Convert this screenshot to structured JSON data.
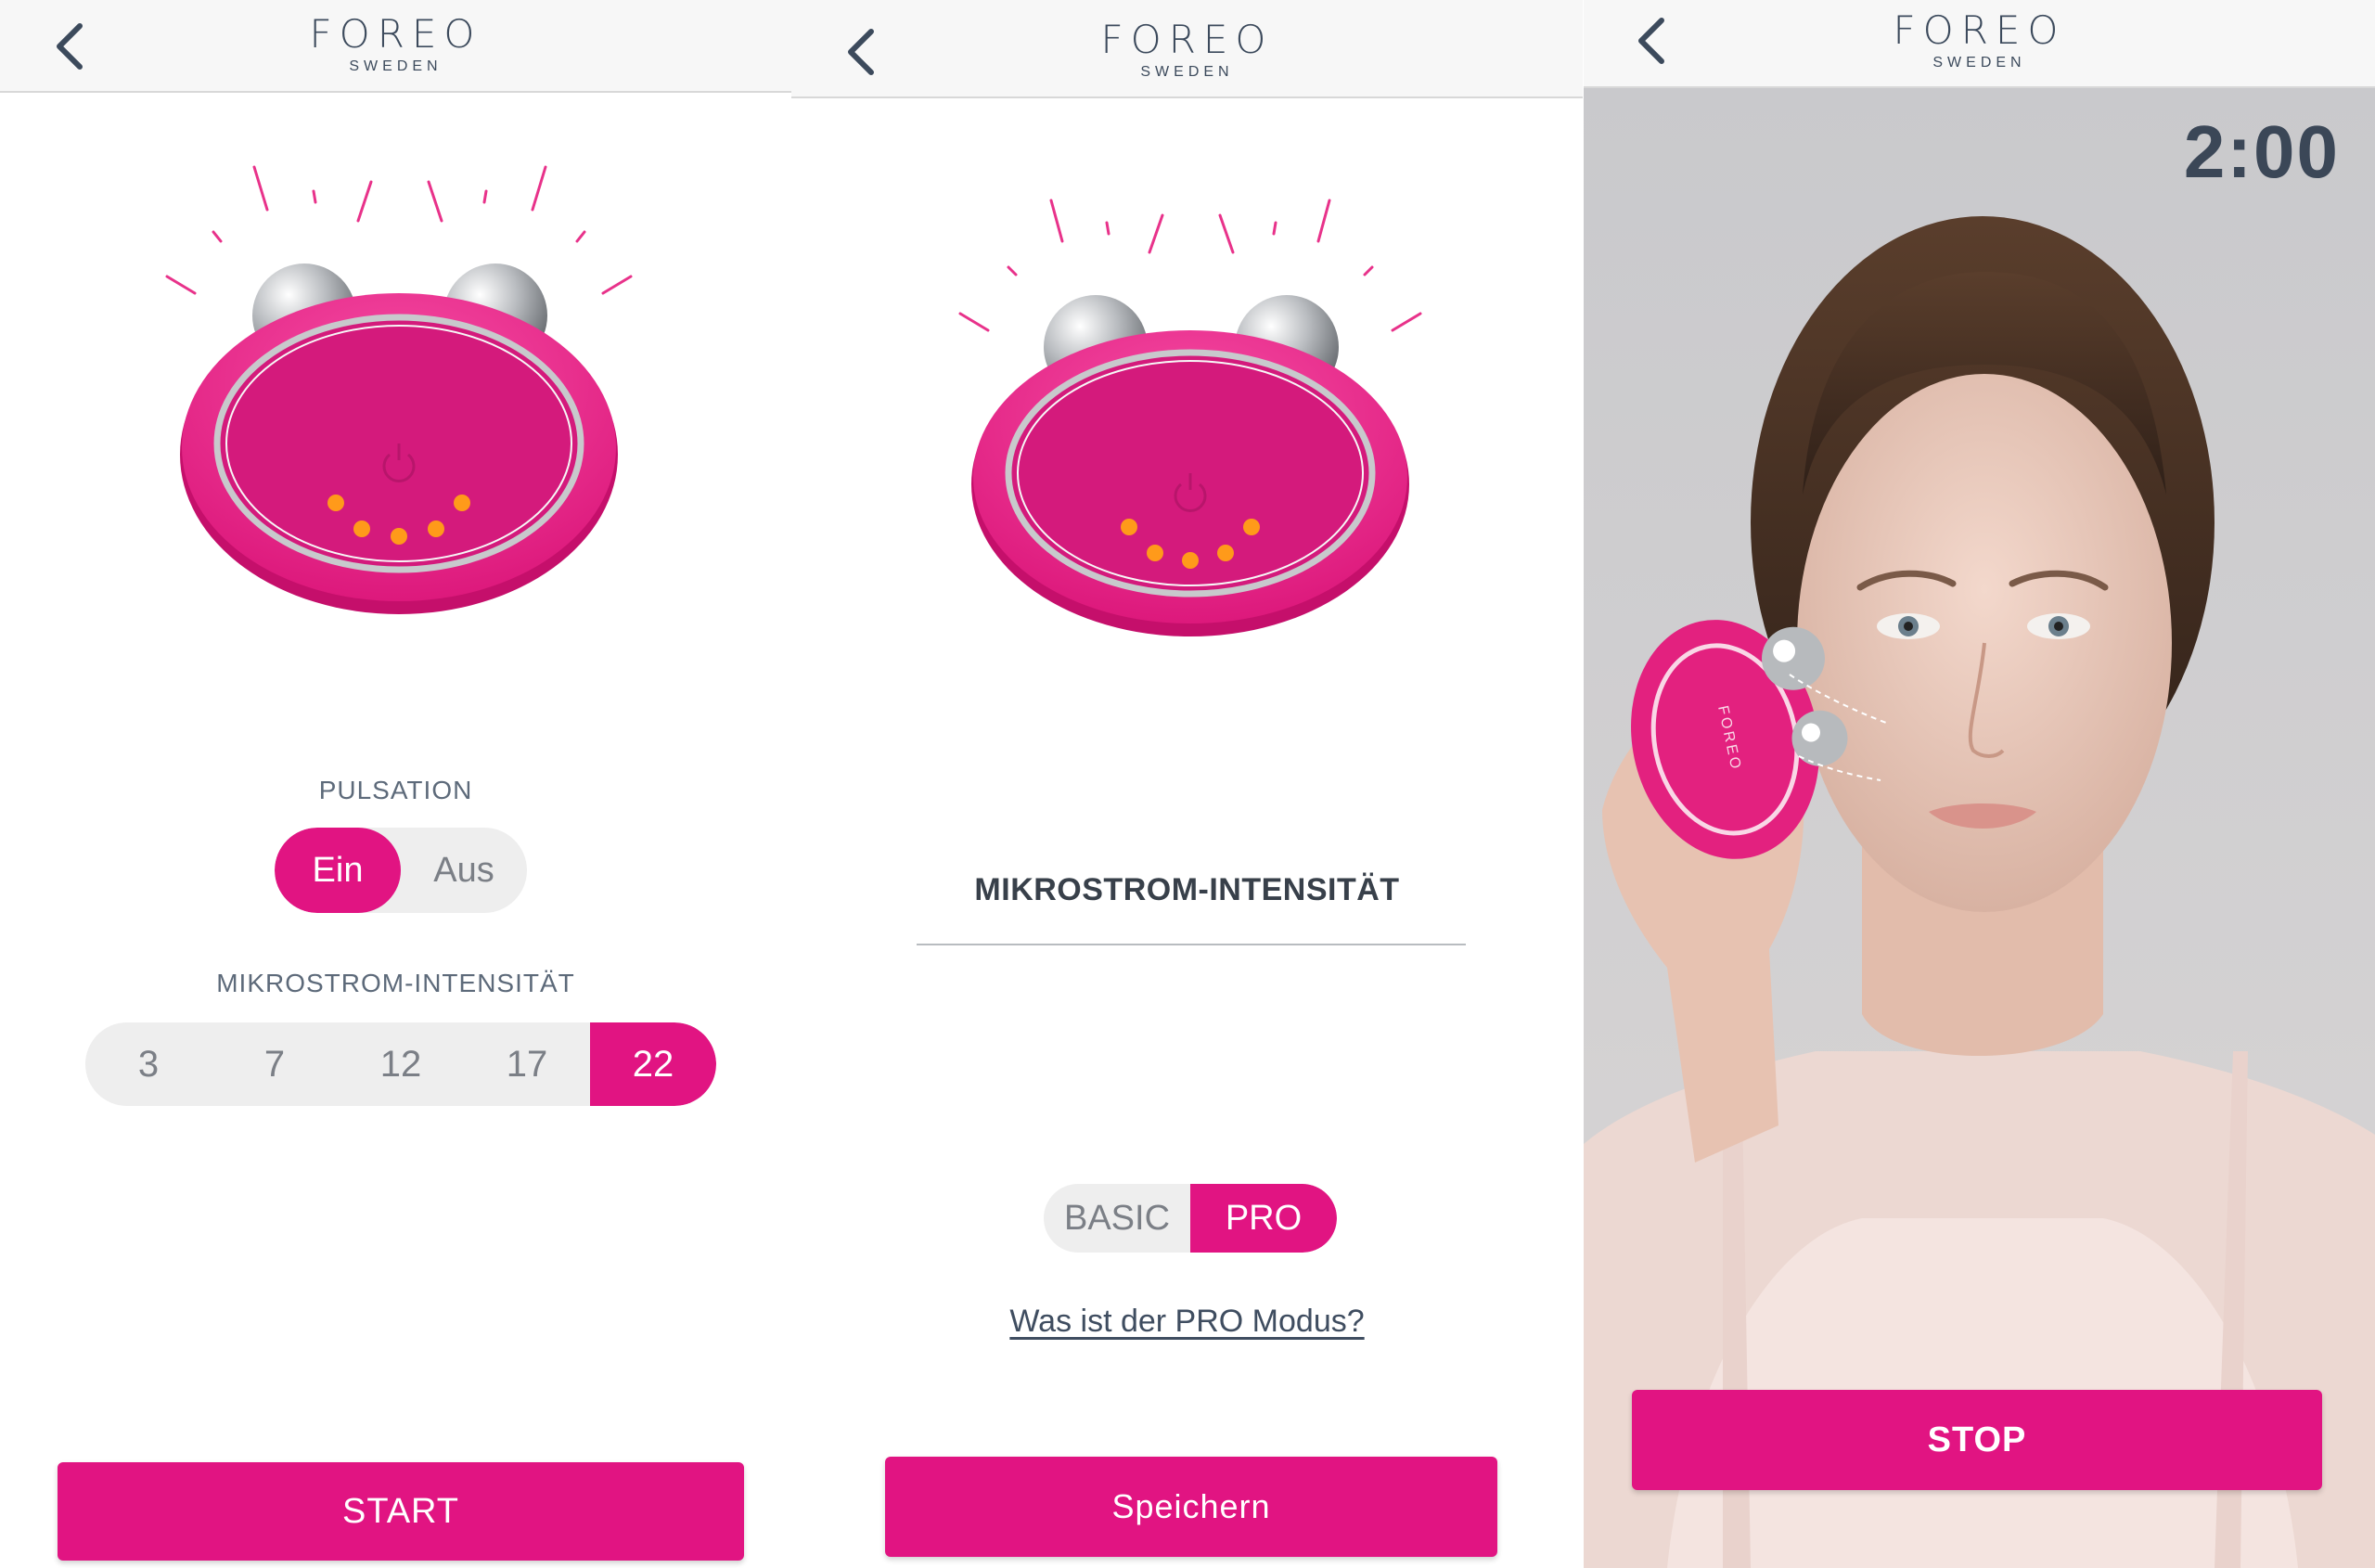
{
  "brand": {
    "logo": "FOREO",
    "sub": "SWEDEN"
  },
  "colors": {
    "accent": "#e11482",
    "dark_text": "#3c4a5c",
    "led": "#ff8c10"
  },
  "screen1": {
    "pulsation_label": "PULSATION",
    "pulsation_options": [
      "Ein",
      "Aus"
    ],
    "pulsation_selected": "Ein",
    "intensity_label": "MIKROSTROM-INTENSITÄT",
    "intensity_options": [
      "3",
      "7",
      "12",
      "17",
      "22"
    ],
    "intensity_selected": "22",
    "start_label": "START"
  },
  "screen2": {
    "title": "MIKROSTROM-INTENSITÄT",
    "mode_options": [
      "BASIC",
      "PRO"
    ],
    "mode_selected": "PRO",
    "pro_link": "Was ist der PRO Modus?",
    "save_label": "Speichern"
  },
  "screen3": {
    "timer": "2:00",
    "stop_label": "STOP",
    "device_print": "FOREO"
  },
  "icons": {
    "back": "chevron-left-icon",
    "power": "power-icon"
  }
}
